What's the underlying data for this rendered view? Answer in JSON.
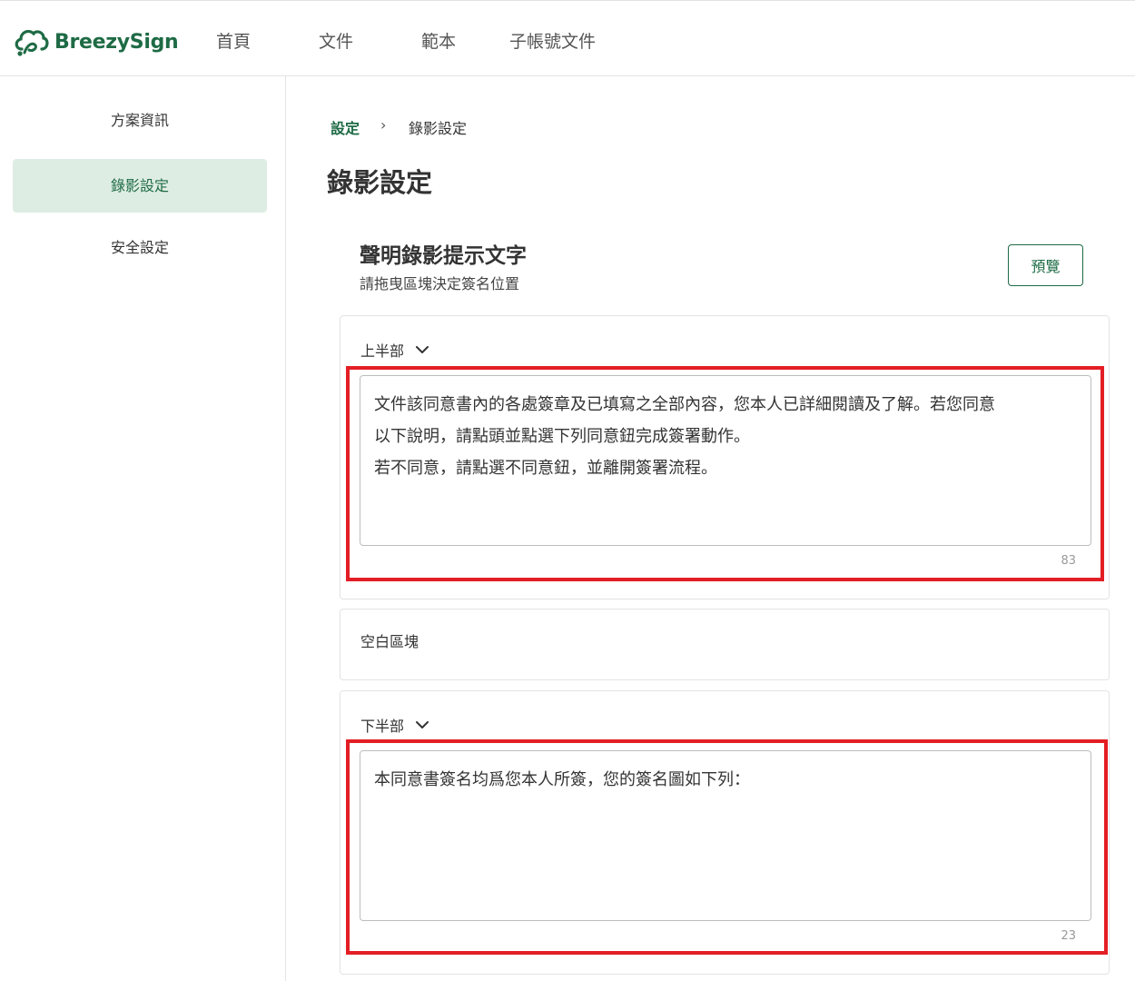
{
  "brand": {
    "name": "BreezySign",
    "color": "#1e6b45"
  },
  "nav": {
    "items": [
      "首頁",
      "文件",
      "範本",
      "子帳號文件"
    ]
  },
  "sidebar": {
    "items": [
      {
        "label": "方案資訊",
        "active": false
      },
      {
        "label": "錄影設定",
        "active": true
      },
      {
        "label": "安全設定",
        "active": false
      }
    ]
  },
  "breadcrumb": {
    "parent": "設定",
    "separator": "›",
    "current": "錄影設定"
  },
  "page": {
    "title": "錄影設定"
  },
  "section": {
    "title": "聲明錄影提示文字",
    "subtitle": "請拖曳區塊決定簽名位置",
    "preview_label": "預覽"
  },
  "blocks": {
    "upper": {
      "label": "上半部",
      "text": "文件該同意書內的各處簽章及已填寫之全部內容，您本人已詳細閱讀及了解。若您同意\n以下說明，請點頭並點選下列同意鈕完成簽署動作。\n若不同意，請點選不同意鈕，並離開簽署流程。",
      "count": "83"
    },
    "blank": {
      "label": "空白區塊"
    },
    "lower": {
      "label": "下半部",
      "text": "本同意書簽名均爲您本人所簽，您的簽名圖如下列：",
      "count": "23"
    }
  },
  "colors": {
    "accent": "#1e6b45",
    "active_bg": "#deede3",
    "highlight": "#e31e24"
  },
  "icons": {
    "logo": "cloud-sign-icon",
    "collapse": "chevron-down-icon"
  }
}
